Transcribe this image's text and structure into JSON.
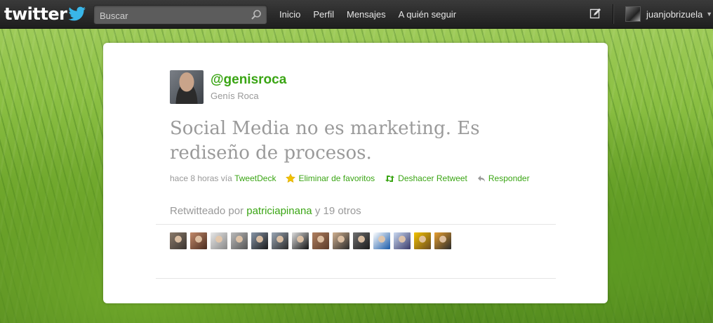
{
  "topbar": {
    "logo_text": "twitter",
    "search_placeholder": "Buscar",
    "nav": [
      "Inicio",
      "Perfil",
      "Mensajes",
      "A quién seguir"
    ],
    "username": "juanjobrizuela"
  },
  "tweet": {
    "handle": "@genisroca",
    "name": "Genís Roca",
    "text": "Social Media no es marketing. Es rediseño de procesos.",
    "time": "hace 8 horas",
    "via_label": "vía",
    "via_app": "TweetDeck",
    "favorite_label": "Eliminar de favoritos",
    "retweet_label": "Deshacer Retweet",
    "reply_label": "Responder",
    "retweeted_prefix": "Retwitteado por",
    "retweeted_by": "patriciapinana",
    "retweeted_suffix": "y 19 otros"
  },
  "colors": {
    "accent": "#3aa514",
    "star": "#f2c200",
    "topbar": "#2a2a2a"
  },
  "retweeter_avatars": 14
}
